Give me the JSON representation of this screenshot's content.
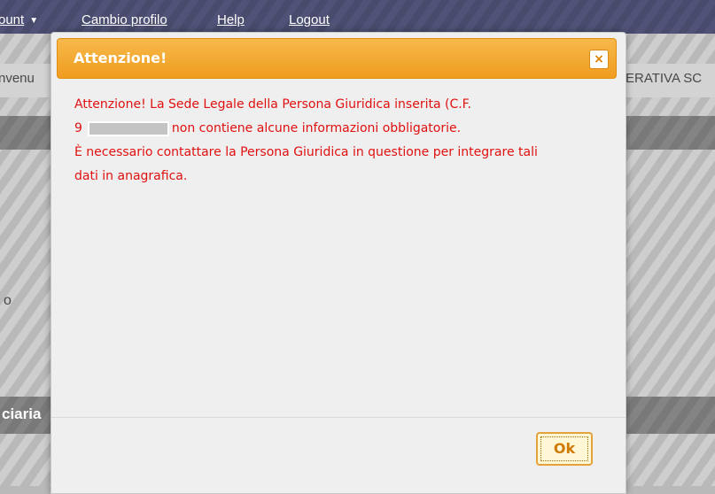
{
  "navbar": {
    "account_label": "ount",
    "items": [
      "Cambio profilo",
      "Help",
      "Logout"
    ]
  },
  "background": {
    "welcome_left": "nvenu",
    "welcome_right": "ERATIVA SC",
    "left_fragment": "o",
    "section_label": "ciaria"
  },
  "dialog": {
    "title": "Attenzione!",
    "close_symbol": "×",
    "message": {
      "line1": "Attenzione! La Sede Legale della Persona Giuridica inserita (C.F.",
      "line2_prefix": "9",
      "line2_suffix": "non contiene alcune informazioni obbligatorie.",
      "line3": "È necessario contattare la Persona Giuridica in questione per integrare tali",
      "line4": "dati in anagrafica."
    },
    "ok_label": "Ok"
  },
  "colors": {
    "header_orange": "#f09c1f",
    "message_red": "#e01010",
    "navbar": "#3d4068"
  }
}
